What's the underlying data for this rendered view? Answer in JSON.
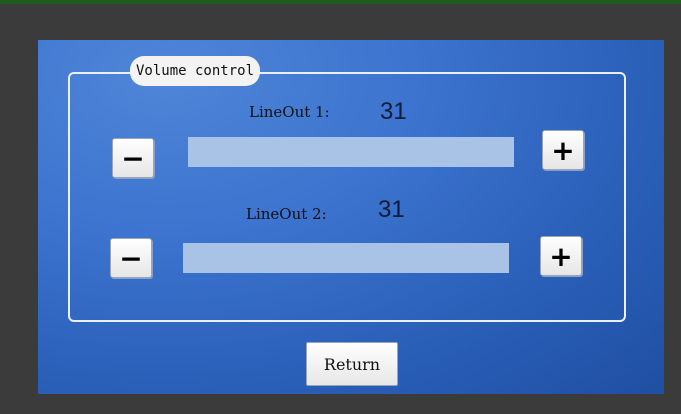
{
  "panel": {
    "title": "Volume control"
  },
  "channels": [
    {
      "label": "LineOut 1:",
      "value": "31",
      "minus_label": "−",
      "plus_label": "+",
      "level_fraction": 0.0
    },
    {
      "label": "LineOut 2:",
      "value": "31",
      "minus_label": "−",
      "plus_label": "+",
      "level_fraction": 0.0
    }
  ],
  "footer": {
    "return_label": "Return"
  },
  "colors": {
    "screen_background": "#3c74cf",
    "slider_track": "#a9c3e6"
  }
}
